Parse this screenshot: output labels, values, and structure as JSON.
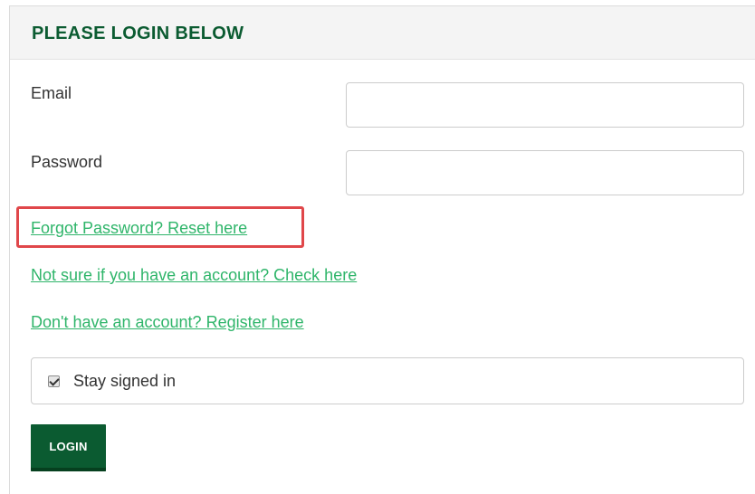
{
  "panel": {
    "title": "PLEASE LOGIN BELOW"
  },
  "form": {
    "email_label": "Email",
    "email_value": "",
    "password_label": "Password",
    "password_value": ""
  },
  "links": {
    "forgot_password": "Forgot Password? Reset here",
    "check_account": "Not sure if you have an account? Check here",
    "register": "Don't have an account? Register here"
  },
  "stay_signed_in": {
    "label": "Stay signed in",
    "checked": true
  },
  "login_button_label": "LOGIN",
  "colors": {
    "brand_green": "#0b5b31",
    "link_green": "#2fb56a",
    "highlight_red": "#e0474a"
  }
}
